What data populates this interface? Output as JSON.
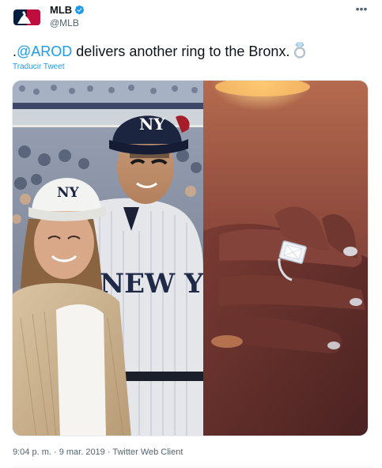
{
  "account": {
    "name": "MLB",
    "handle": "@MLB",
    "verified": true,
    "avatar_icon": "mlb-logo-icon"
  },
  "tweet": {
    "prefix": ".",
    "mention": "@AROD",
    "body": " delivers another ring to the Bronx.",
    "emoji_icon": "ring-icon",
    "translate_label": "Traducir Tweet"
  },
  "media": {
    "left_photo_icon": "couple-yankees-photo",
    "left_cap_logo": "NY",
    "left_jersey_text": "NEW YORK",
    "right_photo_icon": "engagement-ring-hand-photo"
  },
  "meta": {
    "time": "9:04 p. m.",
    "separator": " · ",
    "date": "9 mar. 2019",
    "client": "Twitter Web Client"
  },
  "colors": {
    "accent": "#1d9bf0",
    "text": "#0f1419",
    "secondary": "#536471"
  }
}
